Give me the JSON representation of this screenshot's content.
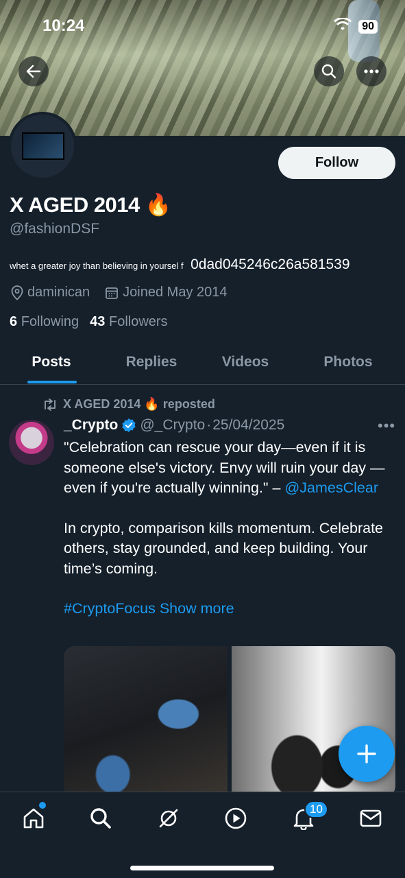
{
  "status_bar": {
    "time": "10:24",
    "battery": "90"
  },
  "profile": {
    "name": "X AGED 2014",
    "name_emoji": "🔥",
    "handle": "@fashionDSF",
    "bio_small": "whet a greater joy than believing in yoursel f",
    "bio_code": "0dad045246c26a581539",
    "location": "daminican",
    "joined": "Joined May 2014",
    "following_count": "6",
    "following_label": "Following",
    "followers_count": "43",
    "followers_label": "Followers",
    "follow_button": "Follow"
  },
  "tabs": [
    {
      "label": "Posts",
      "active": true
    },
    {
      "label": "Replies"
    },
    {
      "label": "Videos"
    },
    {
      "label": "Photos"
    }
  ],
  "post": {
    "repost_label": "X AGED 2014 🔥 reposted",
    "author_name": "_Crypto",
    "author_handle": "@_Crypto",
    "separator": "·",
    "date": "25/04/2025",
    "quote": "\"Celebration can rescue your day—even if it is someone else's victory. Envy will ruin your day —even if you're actually winning.\" –",
    "mention": "@JamesClear",
    "body": "In crypto, comparison kills momentum. Celebrate others, stay grounded, and keep building. Your time’s coming.",
    "hashtag": "#CryptoFocus",
    "show_more": "Show more"
  },
  "bottom_nav": {
    "items": [
      "home-icon",
      "search-icon",
      "grok-icon",
      "video-icon",
      "notifications-icon",
      "messages-icon"
    ],
    "notification_badge": "10"
  },
  "colors": {
    "accent": "#1d9bf0",
    "background": "#15202b",
    "muted": "#8b98a5"
  }
}
